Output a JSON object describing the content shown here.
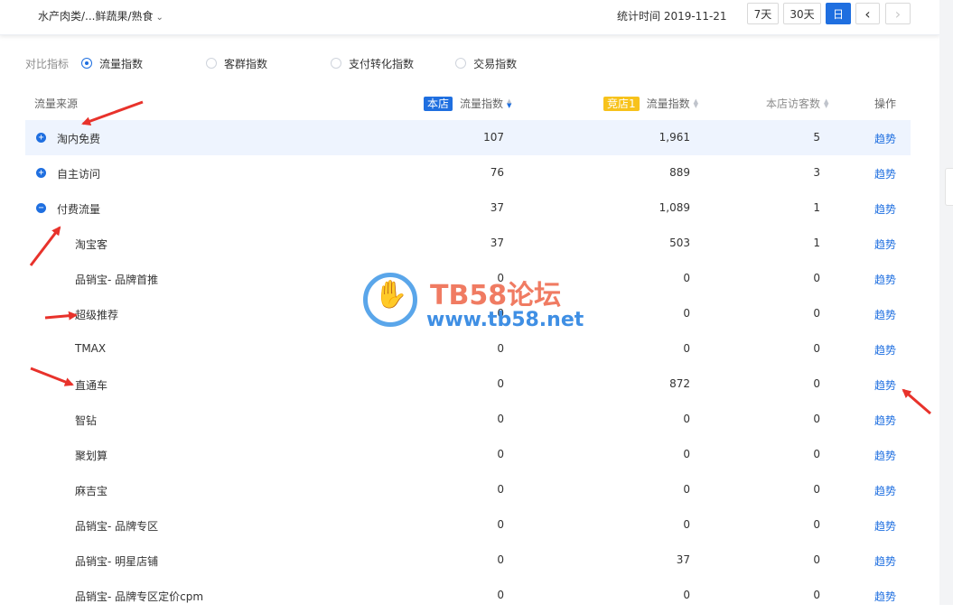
{
  "header": {
    "category": "水产肉类/...鲜蔬果/熟食",
    "stat_time": "统计时间 2019-11-21",
    "range_buttons": [
      "7天",
      "30天",
      "日"
    ],
    "prev": "‹",
    "next": "›"
  },
  "compare": {
    "label": "对比指标",
    "options": [
      "流量指数",
      "客群指数",
      "支付转化指数",
      "交易指数"
    ],
    "selected": "流量指数"
  },
  "table": {
    "headers": {
      "source": "流量来源",
      "own_badge": "本店",
      "own_metric": "流量指数",
      "rival_badge": "竞店1",
      "rival_metric": "流量指数",
      "visitors": "本店访客数",
      "action": "操作"
    },
    "action_label": "趋势",
    "rows": [
      {
        "name": "淘内免费",
        "own": "107",
        "rival": "1,961",
        "visitors": "5",
        "toggle": "+"
      },
      {
        "name": "自主访问",
        "own": "76",
        "rival": "889",
        "visitors": "3",
        "toggle": "+"
      },
      {
        "name": "付费流量",
        "own": "37",
        "rival": "1,089",
        "visitors": "1",
        "toggle": "−"
      },
      {
        "name": "淘宝客",
        "own": "37",
        "rival": "503",
        "visitors": "1",
        "toggle": ""
      },
      {
        "name": "品销宝- 品牌首推",
        "own": "0",
        "rival": "0",
        "visitors": "0",
        "toggle": ""
      },
      {
        "name": "超级推荐",
        "own": "0",
        "rival": "0",
        "visitors": "0",
        "toggle": ""
      },
      {
        "name": "TMAX",
        "own": "0",
        "rival": "0",
        "visitors": "0",
        "toggle": ""
      },
      {
        "name": "直通车",
        "own": "0",
        "rival": "872",
        "visitors": "0",
        "toggle": ""
      },
      {
        "name": "智钻",
        "own": "0",
        "rival": "0",
        "visitors": "0",
        "toggle": ""
      },
      {
        "name": "聚划算",
        "own": "0",
        "rival": "0",
        "visitors": "0",
        "toggle": ""
      },
      {
        "name": "麻吉宝",
        "own": "0",
        "rival": "0",
        "visitors": "0",
        "toggle": ""
      },
      {
        "name": "品销宝- 品牌专区",
        "own": "0",
        "rival": "0",
        "visitors": "0",
        "toggle": ""
      },
      {
        "name": "品销宝- 明星店铺",
        "own": "0",
        "rival": "37",
        "visitors": "0",
        "toggle": ""
      },
      {
        "name": "品销宝- 品牌专区定价cpm",
        "own": "0",
        "rival": "0",
        "visitors": "0",
        "toggle": ""
      }
    ]
  },
  "watermark": {
    "title": "TB58论坛",
    "url": "www.tb58.net"
  },
  "colors": {
    "accent": "#1f6fe0",
    "highlight_row": "#eef4fe",
    "rival_badge": "#f7c21b",
    "annotation_arrow": "#e8322b"
  }
}
